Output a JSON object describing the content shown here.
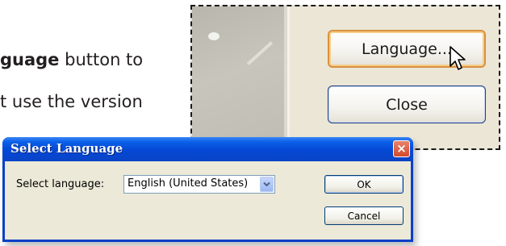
{
  "document": {
    "line1_bold": "guage",
    "line1_rest": " button to",
    "line2": "t use the version"
  },
  "callout": {
    "language_button": "Language...",
    "close_button": "Close"
  },
  "dialog": {
    "title": "Select Language",
    "close_glyph": "×",
    "label": "Select language:",
    "selected_language": "English (United States)",
    "ok_button": "OK",
    "cancel_button": "Cancel"
  },
  "colors": {
    "titlebar": "#0a5fe8",
    "focus_orange": "#d9913e",
    "dialog_bg": "#ece9d8"
  },
  "icons": {
    "cursor": "pointer-cursor-icon",
    "dropdown": "chevron-down-icon"
  }
}
